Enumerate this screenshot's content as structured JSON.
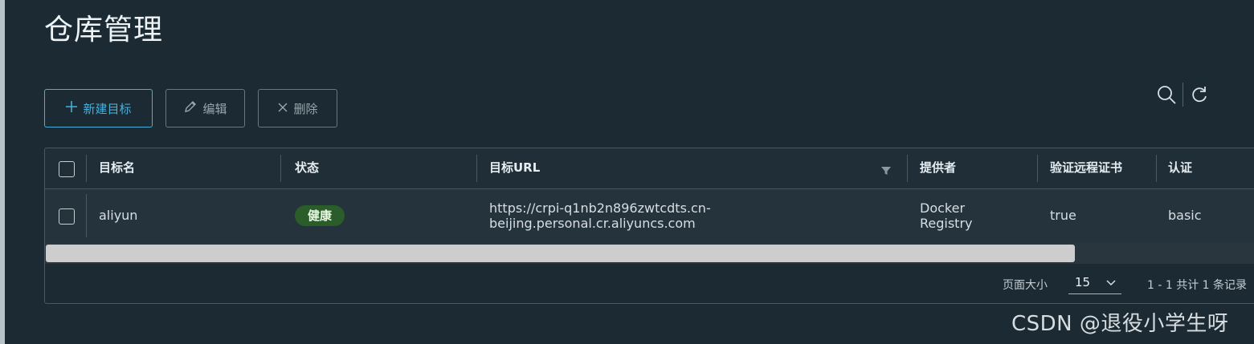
{
  "page": {
    "title": "仓库管理"
  },
  "toolbar": {
    "new_label": "新建目标",
    "edit_label": "编辑",
    "delete_label": "删除"
  },
  "table": {
    "columns": [
      "目标名",
      "状态",
      "目标URL",
      "提供者",
      "验证远程证书",
      "认证"
    ],
    "rows": [
      {
        "name": "aliyun",
        "status": "健康",
        "url_line1": "https://crpi-q1nb2n896zwtcdts.cn-",
        "url_line2": "beijing.personal.cr.aliyuncs.com",
        "provider_line1": "Docker",
        "provider_line2": "Registry",
        "verify_cert": "true",
        "auth": "basic"
      }
    ]
  },
  "pagination": {
    "page_size_label": "页面大小",
    "page_size": "15",
    "summary": "1 - 1 共计 1 条记录"
  },
  "watermark": "CSDN @退役小学生呀",
  "colors": {
    "background": "#1b2a33",
    "accent": "#49afd9",
    "status_badge": "#2b5d2a"
  },
  "icons": [
    "plus-icon",
    "pencil-icon",
    "close-icon",
    "search-icon",
    "refresh-icon",
    "filter-icon",
    "chevron-down-icon"
  ]
}
